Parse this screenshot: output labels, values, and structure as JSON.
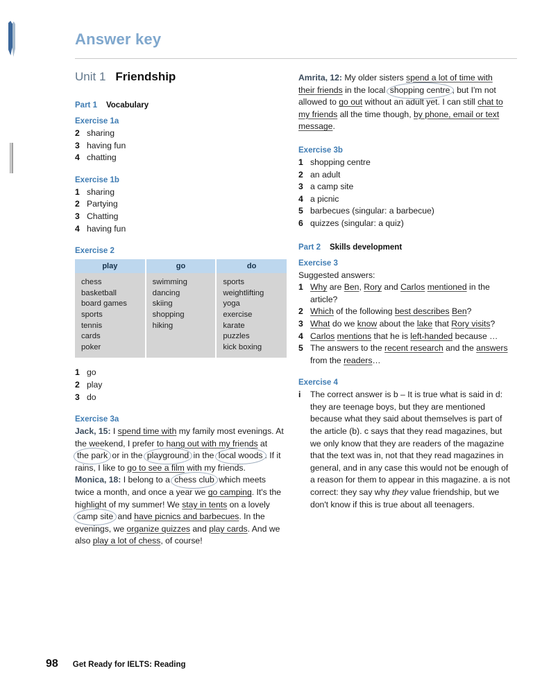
{
  "document": {
    "title": "Answer key",
    "unit_label": "Unit 1",
    "unit_name": "Friendship"
  },
  "footer": {
    "page_number": "98",
    "book_title": "Get Ready for IELTS: Reading"
  },
  "left_column": {
    "part1": {
      "label": "Part 1",
      "name": "Vocabulary"
    },
    "exercise_1a": {
      "heading": "Exercise 1a",
      "items": [
        {
          "num": "2",
          "text": "sharing"
        },
        {
          "num": "3",
          "text": "having fun"
        },
        {
          "num": "4",
          "text": "chatting"
        }
      ]
    },
    "exercise_1b": {
      "heading": "Exercise 1b",
      "items": [
        {
          "num": "1",
          "text": "sharing"
        },
        {
          "num": "2",
          "text": "Partying"
        },
        {
          "num": "3",
          "text": "Chatting"
        },
        {
          "num": "4",
          "text": "having fun"
        }
      ]
    },
    "exercise_2": {
      "heading": "Exercise 2",
      "table": {
        "columns": [
          "play",
          "go",
          "do"
        ],
        "cells": [
          [
            "chess",
            "basketball",
            "board games",
            "sports",
            "tennis",
            "cards",
            "poker"
          ],
          [
            "swimming",
            "dancing",
            "skiing",
            "shopping",
            "hiking"
          ],
          [
            "sports",
            "weightlifting",
            "yoga",
            "exercise",
            "karate",
            "puzzles",
            "kick boxing"
          ]
        ]
      },
      "items": [
        {
          "num": "1",
          "text": "go"
        },
        {
          "num": "2",
          "text": "play"
        },
        {
          "num": "3",
          "text": "do"
        }
      ]
    },
    "exercise_3a": {
      "heading": "Exercise 3a",
      "jack": {
        "speaker": "Jack, 15:",
        "segments": [
          {
            "text": " I ",
            "style": "plain"
          },
          {
            "text": "spend time with",
            "style": "underline"
          },
          {
            "text": " my family most evenings. At the weekend, I prefer to ",
            "style": "plain"
          },
          {
            "text": "hang out with my friends",
            "style": "underline"
          },
          {
            "text": " at ",
            "style": "plain"
          },
          {
            "text": "the park",
            "style": "circle"
          },
          {
            "text": " or in the ",
            "style": "plain"
          },
          {
            "text": "playground",
            "style": "circle"
          },
          {
            "text": " in the ",
            "style": "plain"
          },
          {
            "text": "local woods",
            "style": "circle"
          },
          {
            "text": ". If it rains, I like to ",
            "style": "plain"
          },
          {
            "text": "go to see a film",
            "style": "underline"
          },
          {
            "text": " with my friends.",
            "style": "plain"
          }
        ]
      },
      "monica": {
        "speaker": "Monica, 18:",
        "segments": [
          {
            "text": " I belong to a ",
            "style": "plain"
          },
          {
            "text": "chess club",
            "style": "circle"
          },
          {
            "text": " which meets twice a month, and once a year we ",
            "style": "plain"
          },
          {
            "text": "go camping",
            "style": "underline"
          },
          {
            "text": ". It's the highlight of my summer! We ",
            "style": "plain"
          },
          {
            "text": "stay in tents",
            "style": "underline"
          },
          {
            "text": " on a lovely ",
            "style": "plain"
          },
          {
            "text": "camp site",
            "style": "circle"
          },
          {
            "text": " and ",
            "style": "plain"
          },
          {
            "text": "have picnics and barbecues",
            "style": "underline"
          },
          {
            "text": ". In the evenings, we ",
            "style": "plain"
          },
          {
            "text": "organize quizzes",
            "style": "underline"
          },
          {
            "text": " and ",
            "style": "plain"
          },
          {
            "text": "play cards",
            "style": "underline"
          },
          {
            "text": ". And we also ",
            "style": "plain"
          },
          {
            "text": "play a lot of chess",
            "style": "underline"
          },
          {
            "text": ", of course!",
            "style": "plain"
          }
        ]
      }
    }
  },
  "right_column": {
    "amrita": {
      "speaker": "Amrita, 12:",
      "segments": [
        {
          "text": " My older sisters ",
          "style": "plain"
        },
        {
          "text": "spend a lot of time with their friends",
          "style": "underline"
        },
        {
          "text": " in the local ",
          "style": "plain"
        },
        {
          "text": "shopping centre",
          "style": "circle"
        },
        {
          "text": ", but I'm not allowed to ",
          "style": "plain"
        },
        {
          "text": "go out",
          "style": "underline"
        },
        {
          "text": " without an adult yet. I can still ",
          "style": "plain"
        },
        {
          "text": "chat to my friends",
          "style": "underline"
        },
        {
          "text": " all the time though, ",
          "style": "plain"
        },
        {
          "text": "by phone, email or text message",
          "style": "underline"
        },
        {
          "text": ".",
          "style": "plain"
        }
      ]
    },
    "exercise_3b": {
      "heading": "Exercise 3b",
      "items": [
        {
          "num": "1",
          "text": "shopping centre"
        },
        {
          "num": "2",
          "text": "an adult"
        },
        {
          "num": "3",
          "text": "a camp site"
        },
        {
          "num": "4",
          "text": "a picnic"
        },
        {
          "num": "5",
          "text": "barbecues (singular: a barbecue)"
        },
        {
          "num": "6",
          "text": "quizzes (singular: a quiz)"
        }
      ]
    },
    "part2": {
      "label": "Part 2",
      "name": "Skills development"
    },
    "exercise_3": {
      "heading": "Exercise 3",
      "intro": "Suggested answers:",
      "items": [
        {
          "num": "1",
          "segments": [
            {
              "text": "Why",
              "style": "underline"
            },
            {
              "text": " are ",
              "style": "plain"
            },
            {
              "text": "Ben",
              "style": "underline"
            },
            {
              "text": ", ",
              "style": "plain"
            },
            {
              "text": "Rory",
              "style": "underline"
            },
            {
              "text": " and ",
              "style": "plain"
            },
            {
              "text": "Carlos",
              "style": "underline"
            },
            {
              "text": " ",
              "style": "plain"
            },
            {
              "text": "mentioned",
              "style": "underline"
            },
            {
              "text": " in the article?",
              "style": "plain"
            }
          ]
        },
        {
          "num": "2",
          "segments": [
            {
              "text": "Which",
              "style": "underline"
            },
            {
              "text": " of the following ",
              "style": "plain"
            },
            {
              "text": "best describes",
              "style": "underline"
            },
            {
              "text": " ",
              "style": "plain"
            },
            {
              "text": "Ben",
              "style": "underline"
            },
            {
              "text": "?",
              "style": "plain"
            }
          ]
        },
        {
          "num": "3",
          "segments": [
            {
              "text": "What",
              "style": "underline"
            },
            {
              "text": " do we ",
              "style": "plain"
            },
            {
              "text": "know",
              "style": "underline"
            },
            {
              "text": " about the ",
              "style": "plain"
            },
            {
              "text": "lake",
              "style": "underline"
            },
            {
              "text": " that ",
              "style": "plain"
            },
            {
              "text": "Rory visits",
              "style": "underline"
            },
            {
              "text": "?",
              "style": "plain"
            }
          ]
        },
        {
          "num": "4",
          "segments": [
            {
              "text": "Carlos",
              "style": "underline"
            },
            {
              "text": " ",
              "style": "plain"
            },
            {
              "text": "mentions",
              "style": "underline"
            },
            {
              "text": " that he is ",
              "style": "plain"
            },
            {
              "text": "left-handed",
              "style": "underline"
            },
            {
              "text": " because …",
              "style": "plain"
            }
          ]
        },
        {
          "num": "5",
          "segments": [
            {
              "text": "The answers to the ",
              "style": "plain"
            },
            {
              "text": "recent research",
              "style": "underline"
            },
            {
              "text": " and the ",
              "style": "plain"
            },
            {
              "text": "answers",
              "style": "underline"
            },
            {
              "text": " from the ",
              "style": "plain"
            },
            {
              "text": "readers",
              "style": "underline"
            },
            {
              "text": "…",
              "style": "plain"
            }
          ]
        }
      ]
    },
    "exercise_4": {
      "heading": "Exercise 4",
      "item": {
        "num": "i",
        "segments": [
          {
            "text": "The correct answer is b – It is true what is said in d: they are teenage boys, but they are mentioned because what they said about themselves is part of the article (b). c says that they read magazines, but we only know that they are readers of the magazine that the text was in, not that they read magazines in general, and in any case this would not be enough of a reason for them to appear in this magazine. a is not correct: they say why ",
            "style": "plain"
          },
          {
            "text": "they",
            "style": "italic"
          },
          {
            "text": " value friendship, but we don't know if this is true about all teenagers.",
            "style": "plain"
          }
        ]
      }
    }
  }
}
